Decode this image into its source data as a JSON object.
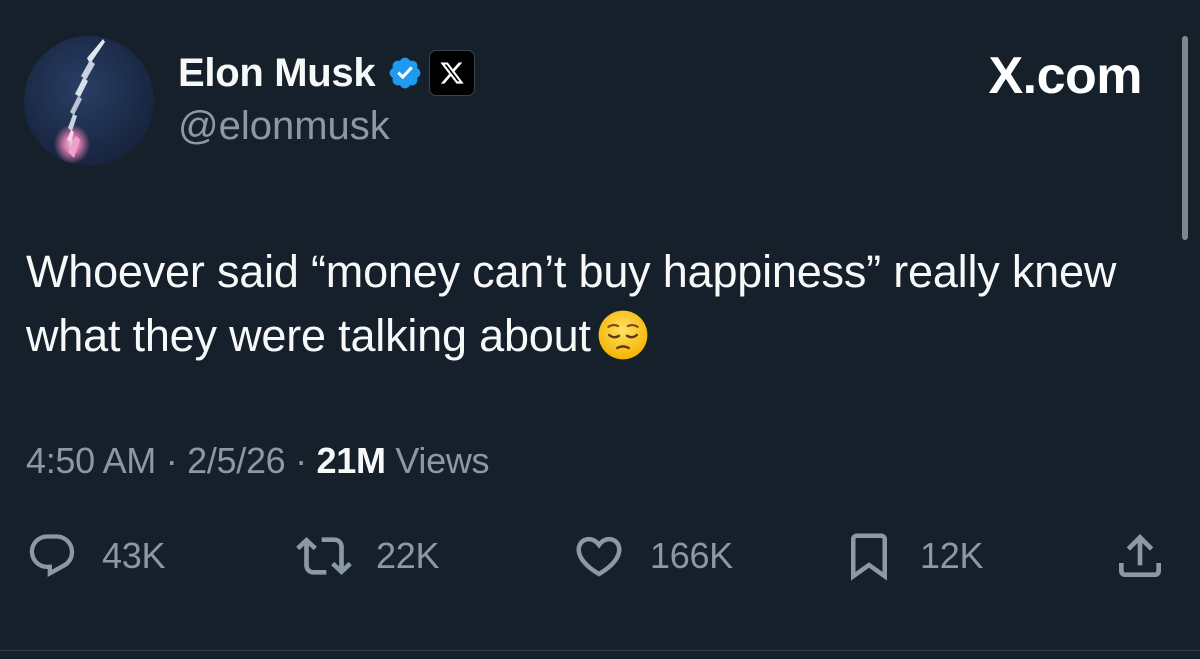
{
  "author": {
    "display_name": "Elon Musk",
    "handle": "@elonmusk",
    "verified_icon": "verified-badge-icon",
    "affiliate_icon": "x-logo-icon"
  },
  "brand": "X.com",
  "tweet": {
    "text": "Whoever said “money can’t buy happiness” really knew what they were talking about",
    "emoji": "pensive-face-emoji"
  },
  "meta": {
    "time": "4:50 AM",
    "separator": "·",
    "date": "2/5/26",
    "views_count": "21M",
    "views_label": "Views"
  },
  "actions": {
    "replies": "43K",
    "reposts": "22K",
    "likes": "166K",
    "bookmarks": "12K"
  },
  "colors": {
    "background": "#15202b",
    "verified": "#1d9bf0",
    "secondary_text": "#8b98a5",
    "primary_text": "#f7f9f9"
  }
}
